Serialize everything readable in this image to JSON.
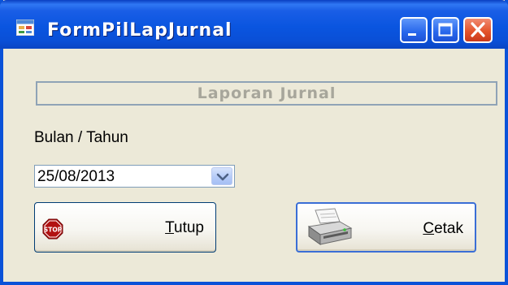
{
  "window": {
    "title": "FormPilLapJurnal",
    "controls": {
      "minimize_icon": "minimize-icon",
      "maximize_icon": "maximize-icon",
      "close_icon": "close-icon"
    }
  },
  "form": {
    "heading": "Laporan Jurnal",
    "period_label": "Bulan / Tahun",
    "date_value": "25/08/2013"
  },
  "buttons": {
    "tutup": {
      "mnemonic": "T",
      "rest": "utup",
      "icon": "stop-sign-icon"
    },
    "cetak": {
      "mnemonic": "C",
      "rest": "etak",
      "icon": "printer-icon"
    }
  },
  "colors": {
    "titlebar": "#0a55e0",
    "window_bg": "#ece9d8",
    "close_button": "#e4552c",
    "disabled_text": "#a7a69b"
  }
}
